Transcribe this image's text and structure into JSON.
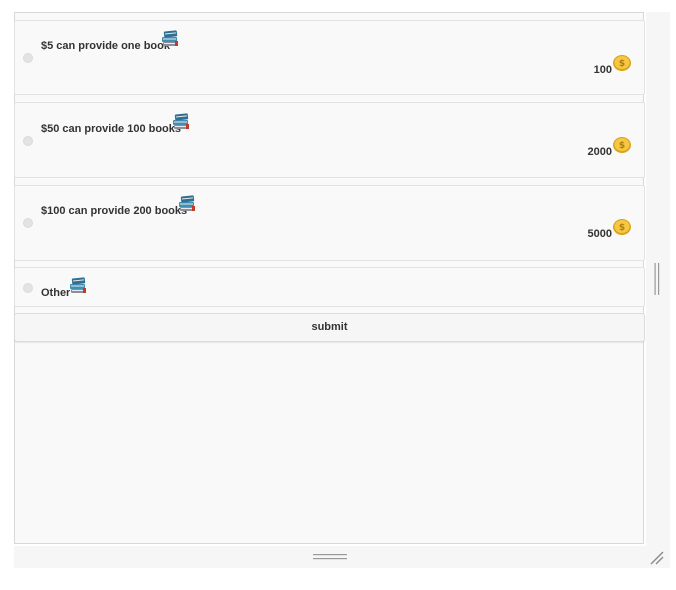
{
  "options": [
    {
      "label": "$5 can provide one book",
      "price": "100",
      "books_icon": "books-icon",
      "coin_icon": "coin-icon"
    },
    {
      "label": "$50 can provide 100 books",
      "price": "2000",
      "books_icon": "books-icon",
      "coin_icon": "coin-icon"
    },
    {
      "label": "$100 can provide 200 books",
      "price": "5000",
      "books_icon": "books-icon",
      "coin_icon": "coin-icon"
    },
    {
      "label": "Other",
      "books_icon": "books-icon"
    }
  ],
  "submit_label": "submit",
  "colors": {
    "panel_bg": "#f9f9f9",
    "border": "#e2e2e2",
    "text": "#333333",
    "coin_gold": "#e8b923"
  }
}
